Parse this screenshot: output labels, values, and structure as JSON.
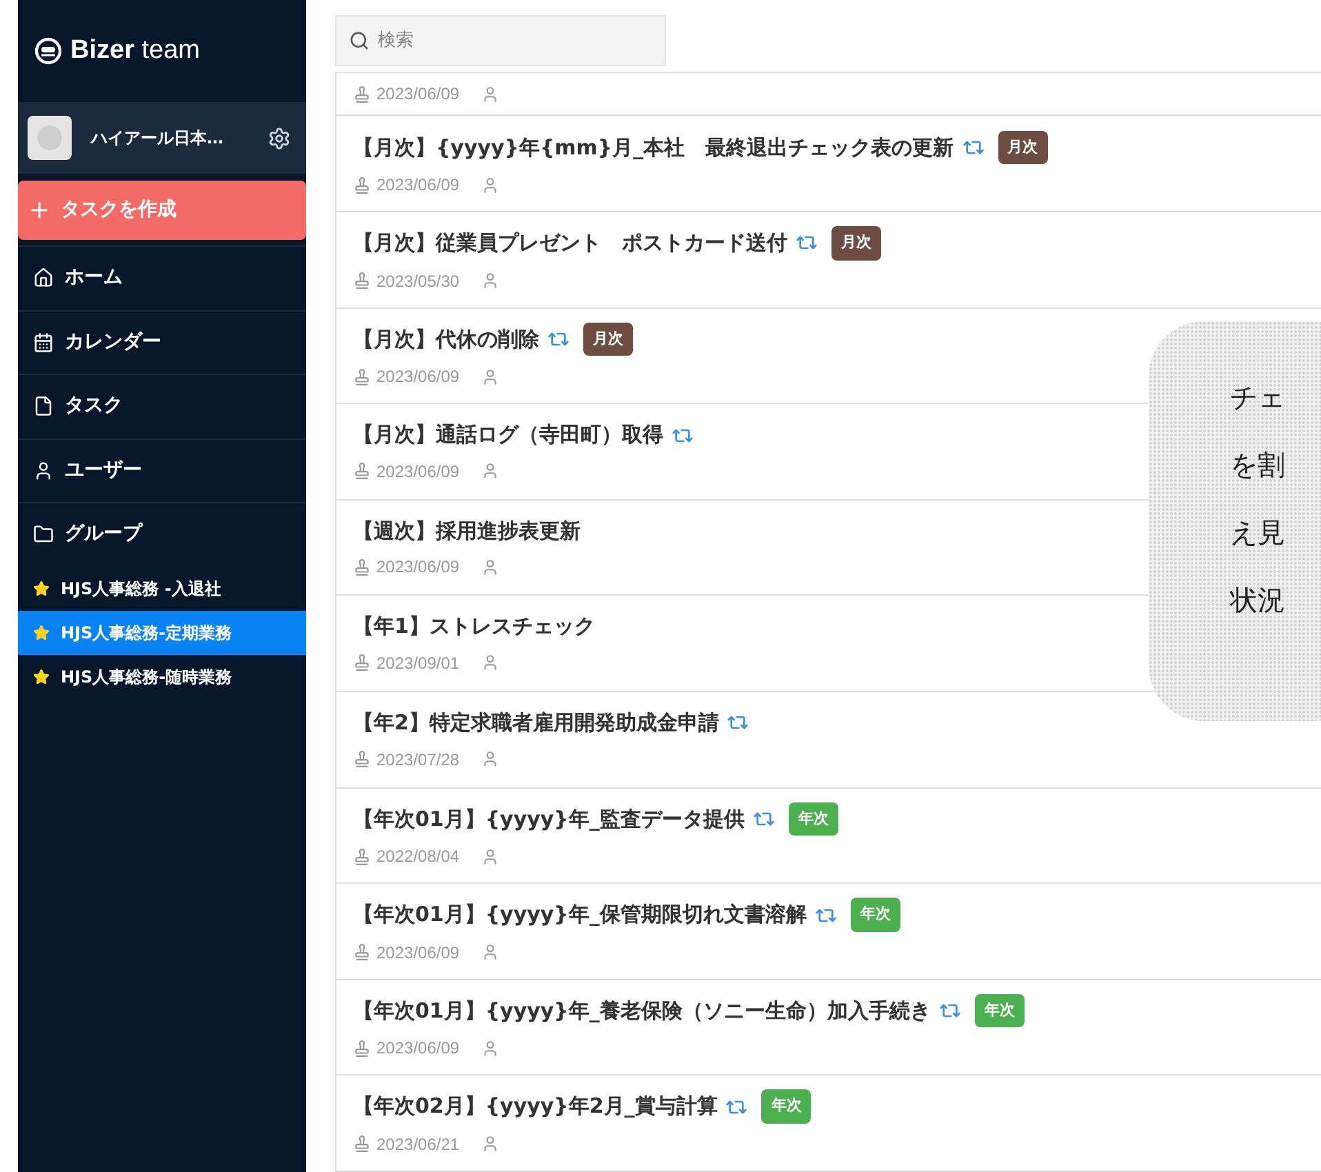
{
  "logo": {
    "brand": "Bizer",
    "suffix": "team"
  },
  "account": {
    "name": "ハイアール日本…"
  },
  "create_button": {
    "icon": "+",
    "label": "タスクを作成"
  },
  "nav": [
    {
      "kind": "home",
      "label": "ホーム"
    },
    {
      "kind": "calendar",
      "label": "カレンダー"
    },
    {
      "kind": "file",
      "label": "タスク"
    },
    {
      "kind": "user",
      "label": "ユーザー"
    },
    {
      "kind": "folder",
      "label": "グループ"
    }
  ],
  "groups": [
    {
      "label": "HJS人事総務 -入退社",
      "selected": false
    },
    {
      "label": "HJS人事総務-定期業務",
      "selected": true
    },
    {
      "label": "HJS人事総務-随時業務",
      "selected": false
    }
  ],
  "search": {
    "placeholder": "検索"
  },
  "tasks": [
    {
      "date": "2023/06/09"
    },
    {
      "title": "【月次】{yyyy}年{mm}月_本社　最終退出チェック表の更新",
      "repeat": true,
      "tag": {
        "label": "月次",
        "color": "#6d4c41"
      },
      "date": "2023/06/09"
    },
    {
      "title": "【月次】従業員プレゼント　ポストカード送付",
      "repeat": true,
      "tag": {
        "label": "月次",
        "color": "#6d4c41"
      },
      "date": "2023/05/30"
    },
    {
      "title": "【月次】代休の削除",
      "repeat": true,
      "tag": {
        "label": "月次",
        "color": "#6d4c41"
      },
      "date": "2023/06/09"
    },
    {
      "title": "【月次】通話ログ（寺田町）取得",
      "repeat": true,
      "date": "2023/06/09"
    },
    {
      "title": "【週次】採用進捗表更新",
      "repeat": false,
      "date": "2023/06/09"
    },
    {
      "title": "【年1】ストレスチェック",
      "repeat": false,
      "date": "2023/09/01"
    },
    {
      "title": "【年2】特定求職者雇用開発助成金申請",
      "repeat": true,
      "date": "2023/07/28"
    },
    {
      "title": "【年次01月】{yyyy}年_監査データ提供",
      "repeat": true,
      "tag": {
        "label": "年次",
        "color": "#4caf50"
      },
      "date": "2022/08/04"
    },
    {
      "title": "【年次01月】{yyyy}年_保管期限切れ文書溶解",
      "repeat": true,
      "tag": {
        "label": "年次",
        "color": "#4caf50"
      },
      "date": "2023/06/09"
    },
    {
      "title": "【年次01月】{yyyy}年_養老保険（ソニー生命）加入手続き",
      "repeat": true,
      "tag": {
        "label": "年次",
        "color": "#4caf50"
      },
      "date": "2023/06/09"
    },
    {
      "title": "【年次02月】{yyyy}年2月_賞与計算",
      "repeat": true,
      "tag": {
        "label": "年次",
        "color": "#4caf50"
      },
      "date": "2023/06/21"
    }
  ],
  "callout": {
    "lines": [
      "チェ",
      "を割",
      "え見",
      "状況"
    ]
  }
}
